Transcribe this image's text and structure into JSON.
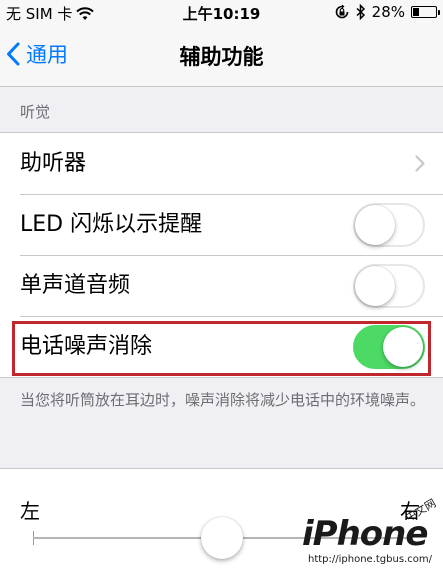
{
  "status_bar": {
    "carrier": "无 SIM 卡",
    "time": "上午10:19",
    "battery": "28%",
    "battery_level": 0.28
  },
  "nav": {
    "back_label": "通用",
    "title": "辅助功能"
  },
  "section_header": "听觉",
  "rows": [
    {
      "label": "助听器",
      "type": "disclosure"
    },
    {
      "label": "LED 闪烁以示提醒",
      "type": "switch",
      "on": false
    },
    {
      "label": "单声道音频",
      "type": "switch",
      "on": false
    },
    {
      "label": "电话噪声消除",
      "type": "switch",
      "on": true
    }
  ],
  "footnote": "当您将听筒放在耳边时，噪声消除将减少电话中的环境噪声。",
  "balance": {
    "left_label": "左",
    "right_label": "右",
    "value": 0.5
  },
  "watermark": {
    "logo": "iPhone",
    "chinese": "中文网",
    "url": "http://iphone.tgbus.com/"
  },
  "colors": {
    "accent": "#007aff",
    "switch_on": "#4cd964",
    "highlight": "#c0272d"
  }
}
